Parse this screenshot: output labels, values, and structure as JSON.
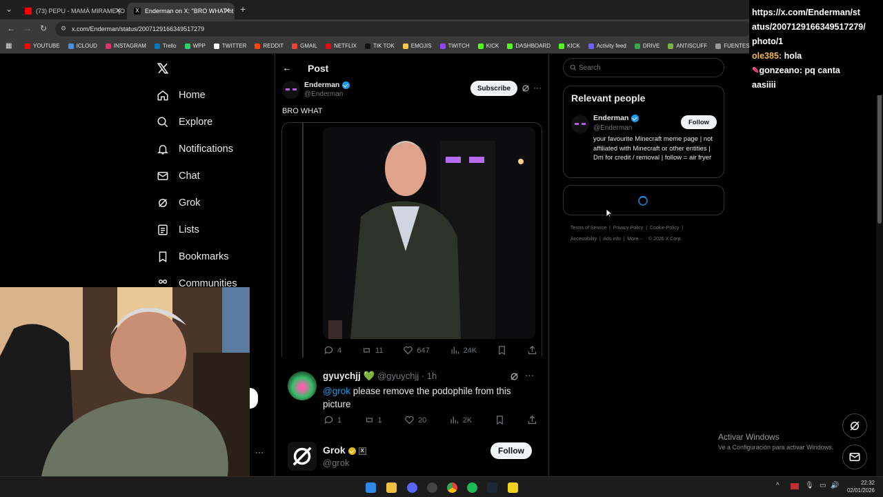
{
  "browser": {
    "tabs": [
      {
        "label": "(73) PEPU - MAMÁ MIRAME (O",
        "color": "#ff0000"
      },
      {
        "label": "Enderman on X: \"BRO WHAT ht",
        "color": "#ffffff"
      }
    ],
    "url": "x.com/Enderman/status/2007129166349517279",
    "bookmarks": [
      "YOUTUBE",
      "ICLOUD",
      "INSTAGRAM",
      "Trello",
      "WPP",
      "TWITTER",
      "REDDIT",
      "GMAIL",
      "NETFLIX",
      "TIK TOK",
      "EMOJIS",
      "TWITCH",
      "KICK",
      "DASHBOARD",
      "KICK",
      "Activity feed",
      "DRIVE",
      "ANTISCUFF",
      "FUENTES"
    ]
  },
  "sidebar": {
    "logo": "X",
    "items": [
      "Home",
      "Explore",
      "Notifications",
      "Chat",
      "Grok",
      "Lists",
      "Bookmarks",
      "Communities"
    ]
  },
  "post": {
    "header": "Post",
    "author_name": "Enderman",
    "author_handle": "@Enderman",
    "subscribe_label": "Subscribe",
    "text": "BRO WHAT",
    "stats": {
      "replies": "4",
      "reposts": "11",
      "likes": "647",
      "views": "24K"
    }
  },
  "reply1": {
    "name": "gyuychjj 💚",
    "handle": "@gyuychjj · 1h",
    "mention": "@grok",
    "text": " please remove the podophile from this picture",
    "stats": {
      "replies": "1",
      "reposts": "1",
      "likes": "20",
      "views": "2K"
    }
  },
  "reply2": {
    "name": "Grok",
    "handle": "@grok",
    "follow_label": "Follow"
  },
  "right": {
    "search_placeholder": "Search",
    "relevant_title": "Relevant people",
    "person_name": "Enderman",
    "person_handle": "@Enderman",
    "person_bio": "your favourite Minecraft meme page | not affiliated with Minecraft or other entities | Dm for credit / removal | follow = air fryer",
    "follow_label": "Follow",
    "footer": [
      "Terms of Service",
      "Privacy Policy",
      "Cookie Policy",
      "Accessibility",
      "Ads info",
      "More ···",
      "© 2026 X Corp."
    ]
  },
  "chat": {
    "lines": [
      "https://x.com/Enderman/st",
      "atus/2007129166349517279/",
      "photo/1"
    ],
    "messages": [
      {
        "user": "ole385:",
        "text": " hola",
        "color": "#f5b74a"
      },
      {
        "user": "gonzeano:",
        "text": " pq canta",
        "color": "#ffffff"
      }
    ],
    "tail": "aasiiii"
  },
  "windows": {
    "activate_title": "Activar Windows",
    "activate_sub": "Ve a Configuración para activar Windows.",
    "time": "22:32",
    "date": "02/01/2026"
  }
}
